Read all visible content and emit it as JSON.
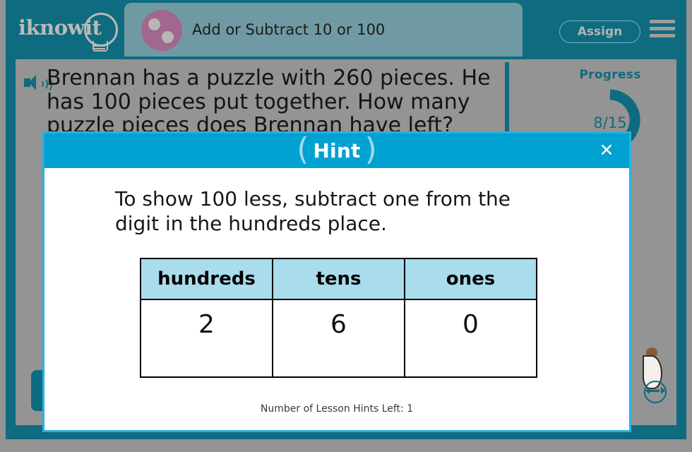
{
  "brand": {
    "logo_text": "iknowit",
    "logo_icon": "lightbulb-icon"
  },
  "header": {
    "lesson_icon": "lesson-dots-icon",
    "lesson_title": "Add or Subtract 10 or 100",
    "assign_label": "Assign",
    "menu_icon": "hamburger-menu-icon"
  },
  "question": {
    "audio_icon": "speaker-icon",
    "text": "Brennan has a puzzle with 260 pieces. He has 100 pieces put together. How many puzzle pieces does Brennan have left?"
  },
  "progress": {
    "label": "Progress",
    "value_text": "8/15",
    "completed": 8,
    "total": 15,
    "ring_color": "#0e6b80",
    "track_color": "#949494"
  },
  "controls": {
    "resize_icon": "resize-horizontal-icon",
    "nav_button": "previous-button"
  },
  "modal": {
    "title": "Hint",
    "close_icon": "close-icon",
    "left_paren": "(",
    "right_paren": ")",
    "hint_text": "To show 100 less, subtract one from the digit in the hundreds place.",
    "hints_left_text": "Number of Lesson Hints Left: 1",
    "header_color": "#00a2d1",
    "border_color": "#25b1e3"
  },
  "place_value_table": {
    "headers": [
      "hundreds",
      "tens",
      "ones"
    ],
    "row": [
      "2",
      "6",
      "0"
    ],
    "header_bg": "#a9dcec"
  }
}
